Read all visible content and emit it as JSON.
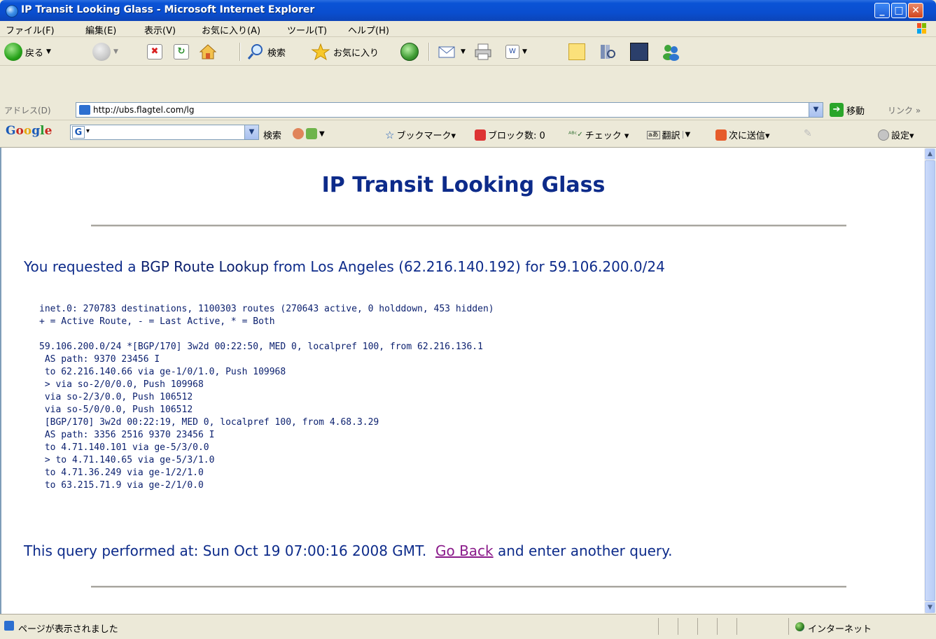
{
  "window": {
    "title": "IP Transit Looking Glass - Microsoft Internet Explorer"
  },
  "menu": [
    "ファイル(F)",
    "編集(E)",
    "表示(V)",
    "お気に入り(A)",
    "ツール(T)",
    "ヘルプ(H)"
  ],
  "toolbar": {
    "back_label": "戻る",
    "search_label": "検索",
    "favorites_label": "お気に入り"
  },
  "address": {
    "label": "アドレス(D)",
    "url": "http://ubs.flagtel.com/lg",
    "go_label": "移動",
    "links_label": "リンク »"
  },
  "googlebar": {
    "logo": "Google",
    "search_label": "検索",
    "bookmarks_label": "ブックマーク▾",
    "blocked_label": "ブロック数: 0",
    "check_label": "チェック ▾",
    "translate_label": "翻訳",
    "send_label": "次に送信▾",
    "settings_label": "設定▾"
  },
  "page": {
    "title": "IP Transit Looking Glass",
    "request_prefix": "You requested a ",
    "request_type": "BGP Route Lookup",
    "request_mid": " from Los Angeles (62.216.140.192) for 59.106.200.0/24",
    "result_text": "inet.0: 270783 destinations, 1100303 routes (270643 active, 0 holddown, 453 hidden)\n+ = Active Route, - = Last Active, * = Both\n\n59.106.200.0/24 *[BGP/170] 3w2d 00:22:50, MED 0, localpref 100, from 62.216.136.1\n AS path: 9370 23456 I\n to 62.216.140.66 via ge-1/0/1.0, Push 109968\n > via so-2/0/0.0, Push 109968\n via so-2/3/0.0, Push 106512\n via so-5/0/0.0, Push 106512\n [BGP/170] 3w2d 00:22:19, MED 0, localpref 100, from 4.68.3.29\n AS path: 3356 2516 9370 23456 I\n to 4.71.140.101 via ge-5/3/0.0\n > to 4.71.140.65 via ge-5/3/1.0\n to 4.71.36.249 via ge-1/2/1.0\n to 63.215.71.9 via ge-2/1/0.0",
    "footer_prefix": "This query performed at: Sun Oct 19 07:00:16 2008 GMT.  ",
    "go_back_link": "Go Back",
    "footer_suffix": " and enter another query."
  },
  "status": {
    "text": "ページが表示されました",
    "zone": "インターネット"
  },
  "colors": {
    "heading": "#0d2b8a",
    "link_visited": "#8a1a8a",
    "titlebar": "#0a4ecf"
  }
}
